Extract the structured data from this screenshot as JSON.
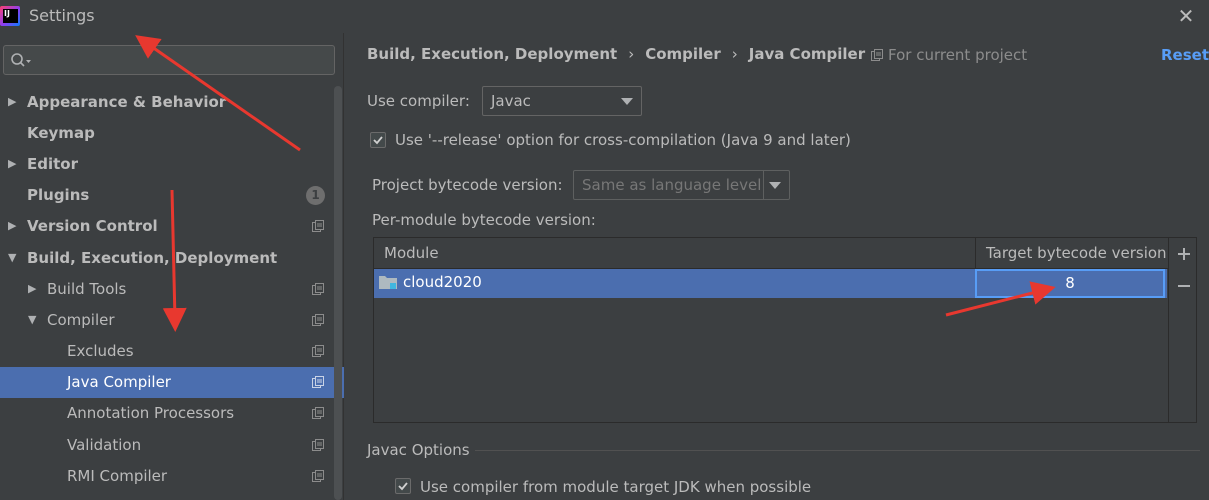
{
  "window": {
    "title": "Settings",
    "close_icon": "close-icon"
  },
  "sidebar": {
    "search": {
      "placeholder": ""
    },
    "items": [
      {
        "label": "Appearance & Behavior",
        "bold": true,
        "expandable": true,
        "expanded": false
      },
      {
        "label": "Keymap",
        "bold": true
      },
      {
        "label": "Editor",
        "bold": true,
        "expandable": true,
        "expanded": false
      },
      {
        "label": "Plugins",
        "bold": true,
        "badge": "1"
      },
      {
        "label": "Version Control",
        "bold": true,
        "expandable": true,
        "expanded": false
      },
      {
        "label": "Build, Execution, Deployment",
        "bold": true,
        "expandable": true,
        "expanded": true
      },
      {
        "label": "Build Tools",
        "expandable": true,
        "expanded": false
      },
      {
        "label": "Compiler",
        "expandable": true,
        "expanded": true
      },
      {
        "label": "Excludes"
      },
      {
        "label": "Java Compiler",
        "selected": true
      },
      {
        "label": "Annotation Processors"
      },
      {
        "label": "Validation"
      },
      {
        "label": "RMI Compiler"
      }
    ]
  },
  "main": {
    "breadcrumb": [
      "Build, Execution, Deployment",
      "Compiler",
      "Java Compiler"
    ],
    "breadcrumb_sep": "›",
    "for_current_project": "For current project",
    "reset_label": "Reset",
    "use_compiler_label": "Use compiler:",
    "use_compiler_value": "Javac",
    "release_option_label": "Use '--release' option for cross-compilation (Java 9 and later)",
    "release_option_checked": true,
    "project_bytecode_label": "Project bytecode version:",
    "project_bytecode_value": "Same as language level",
    "per_module_label": "Per-module bytecode version:",
    "table": {
      "columns": [
        "Module",
        "Target bytecode version"
      ],
      "rows": [
        {
          "module": "cloud2020",
          "target": "8"
        }
      ]
    },
    "javac_options_label": "Javac Options",
    "use_target_jdk_label": "Use compiler from module target JDK when possible",
    "use_target_jdk_checked": true
  },
  "colors": {
    "background": "#3c3f41",
    "selection": "#4b6eaf",
    "link": "#589df6",
    "annotation": "#e8382f"
  }
}
